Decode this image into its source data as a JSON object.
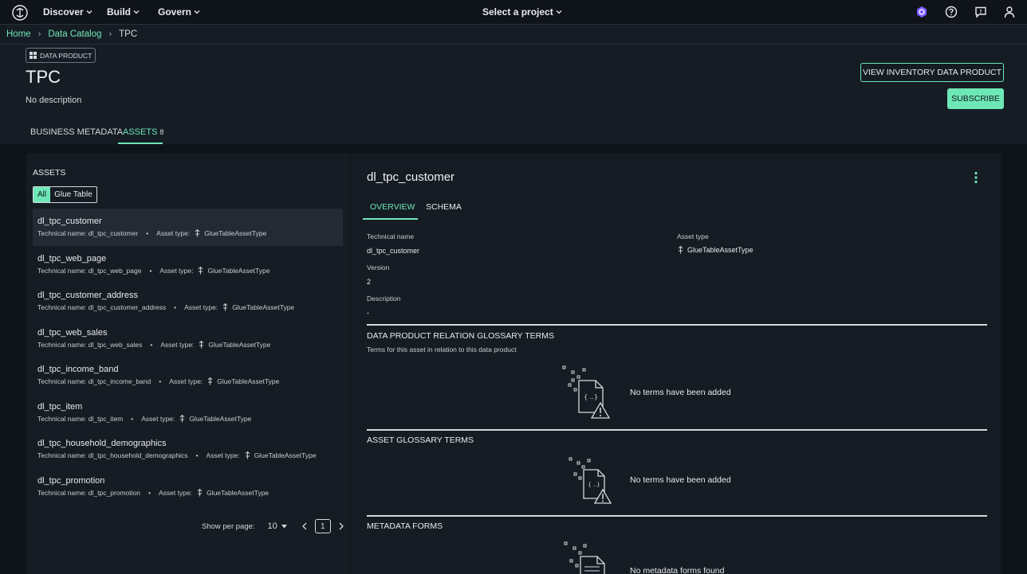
{
  "topnav": {
    "menus": [
      "Discover",
      "Build",
      "Govern"
    ],
    "project_select": "Select a project",
    "icons": [
      "amazon-q-icon",
      "help-icon",
      "feedback-icon",
      "user-icon"
    ]
  },
  "breadcrumb": [
    "Home",
    "Data Catalog",
    "TPC"
  ],
  "header": {
    "badge": "DATA PRODUCT",
    "title": "TPC",
    "description": "No description",
    "btn_view_inventory": "VIEW INVENTORY DATA PRODUCT",
    "btn_subscribe": "SUBSCRIBE",
    "tabs": [
      {
        "label": "BUSINESS METADATA"
      },
      {
        "label": "ASSETS",
        "count": "8"
      }
    ]
  },
  "assets": {
    "heading": "ASSETS",
    "filters": [
      "All",
      "Glue Table"
    ],
    "technical_label": "Technical name:",
    "type_label": "Asset type:",
    "type_value": "GlueTableAssetType",
    "items": [
      {
        "name": "dl_tpc_customer",
        "technical": "dl_tpc_customer"
      },
      {
        "name": "dl_tpc_web_page",
        "technical": "dl_tpc_web_page"
      },
      {
        "name": "dl_tpc_customer_address",
        "technical": "dl_tpc_customer_address"
      },
      {
        "name": "dl_tpc_web_sales",
        "technical": "dl_tpc_web_sales"
      },
      {
        "name": "dl_tpc_income_band",
        "technical": "dl_tpc_income_band"
      },
      {
        "name": "dl_tpc_item",
        "technical": "dl_tpc_item"
      },
      {
        "name": "dl_tpc_household_demographics",
        "technical": "dl_tpc_household_demographics"
      },
      {
        "name": "dl_tpc_promotion",
        "technical": "dl_tpc_promotion"
      }
    ],
    "pagination": {
      "label": "Show per page:",
      "per_page": "10",
      "page": "1"
    }
  },
  "detail": {
    "title": "dl_tpc_customer",
    "tabs": [
      "OVERVIEW",
      "SCHEMA"
    ],
    "technical_name_label": "Technical name",
    "technical_name": "dl_tpc_customer",
    "asset_type_label": "Asset type",
    "asset_type": "GlueTableAssetType",
    "version_label": "Version",
    "version": "2",
    "description_label": "Description",
    "description": "-",
    "sections": [
      {
        "title": "DATA PRODUCT RELATION GLOSSARY TERMS",
        "subtitle": "Terms for this asset in relation to this data product",
        "empty": "No terms have been added"
      },
      {
        "title": "ASSET GLOSSARY TERMS",
        "empty": "No terms have been added"
      },
      {
        "title": "METADATA FORMS",
        "empty": "No metadata forms found"
      }
    ]
  },
  "colors": {
    "accent": "#6ee7b7",
    "background": "#0f141a",
    "panel": "#161c24",
    "selected": "#232a33"
  }
}
